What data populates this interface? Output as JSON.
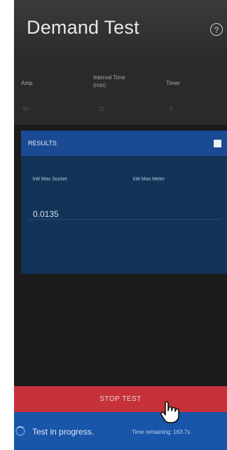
{
  "header": {
    "title": "Demand Test",
    "help_icon": "help-circle-icon"
  },
  "params": {
    "amp_label": "Amp",
    "interval_label": "Interval Time\n(min)",
    "timer_label": "Timer",
    "amp_value": "90",
    "interval_value": "15",
    "timer_value": "0"
  },
  "results": {
    "title": "RESULTS",
    "col1_label": "kW Max Socket",
    "col2_label": "kW Max Meter",
    "value1": "0.0135"
  },
  "stop_button": {
    "label": "STOP TEST"
  },
  "status": {
    "progress_text": "Test in progress.",
    "time_text": "Time remaining: 163.7s"
  },
  "colors": {
    "stop_red": "#c6313a",
    "status_blue": "#1955a8",
    "results_blue": "#1a4a93"
  }
}
